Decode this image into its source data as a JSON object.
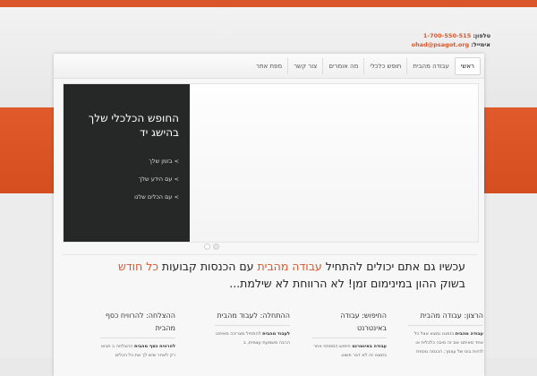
{
  "contact": {
    "phone_label": "טלפון:",
    "phone": "1-700-550-515",
    "email_label": "אימייל:",
    "email": "ohad@psagot.org"
  },
  "nav": {
    "items": [
      {
        "label": "ראשי",
        "active": true
      },
      {
        "label": "עבודה מהבית"
      },
      {
        "label": "חופש כלכלי"
      },
      {
        "label": "מה אומרים"
      },
      {
        "label": "צור קשר"
      },
      {
        "label": "מפת אתר"
      }
    ]
  },
  "slider": {
    "title": "החופש הכלכלי שלך בהישג יד",
    "bullets": [
      "> בזמן שלך",
      "> עם הידע שלך",
      "> עם הכלים שלנו"
    ],
    "dots": 2,
    "active_dot": 1
  },
  "headline": {
    "part1": "עכשיו גם אתם יכולים להתחיל ",
    "highlight1": "עבודה מהבית",
    "part2": " עם הכנסות קבועות ",
    "highlight2": "כל חודש",
    "line2": "בשוק ההון במינימום זמן! לא הרווחת לא שילמת..."
  },
  "columns": [
    {
      "title": "הרצון: עבודה מהבית",
      "lead": "עבודה מהבית",
      "body": " בזמננו נמצא אצל כל אחד מאיתנו אם זה סיבה כלכלית או להיות בוס של עצמך, הכנסה נוספת"
    },
    {
      "title": "החיפוש: עבודה באינטרנט",
      "lead": "עבודה באינטרנט",
      "body": " חיפוש המפתח אחר בזמננו זה לא דבר פשוט"
    },
    {
      "title": "ההתחלה: לעבוד מהבית",
      "lead": "לעבוד מהבית",
      "body": " להתחיל מצריכה מאיתנו הרבה משמעת עצמית, ב"
    },
    {
      "title": "ההצלחה: להרוויח כסף מהבית",
      "lead": "להרוויח כסף מהבית",
      "body": " ההצלחה ב תבוא רק לאחר שיש לך את כל הכלים"
    }
  ]
}
